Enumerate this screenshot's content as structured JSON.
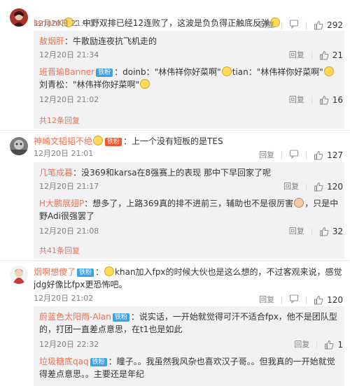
{
  "comments": [
    {
      "user": "larianK",
      "text": "：中野双排已经12连败了，这波是负负得正触底反弹",
      "time": "12月20日 21:00",
      "reply": "回复",
      "likes": "292",
      "subs": [
        {
          "user": "敖烟肝",
          "text": "：牛散励连夜抗飞机走的",
          "time": "12月20日 21:34",
          "reply": "回复",
          "likes": "21"
        },
        {
          "user": "班晋瑜Banner",
          "badge": "铁粉",
          "text1": "：doinb：\"林伟祥你好菜啊\"",
          "text2": "tian：\"林伟祥你好菜啊\"",
          "text3": "刘青松：\"林伟祥你好菜啊\"",
          "time": "12月20日 21:02",
          "reply": "回复",
          "likes": "16"
        }
      ],
      "more": "共12条回复"
    },
    {
      "user": "神崎文韬韬不绝",
      "badge": "铁粉",
      "text": "：上一个没有短板的是TES",
      "time": "12月20日 21:01",
      "reply": "回复",
      "likes": "127",
      "subs": [
        {
          "user": "几笔成暮",
          "text": "：没369和karsa在8强赛上的表现 那中下早回家了呢",
          "time": "12月20日 21:17",
          "reply": "回复",
          "likes": "120"
        },
        {
          "user": "H大鹏展翅P",
          "text": "：想多了，上路369真的排不进前三，辅助也不是很厉害",
          "text2": "，只是中野Adi很强罢了",
          "time": "12月20日 21:08",
          "reply": "回复",
          "likes": "32"
        }
      ],
      "more": "共41条回复"
    },
    {
      "user": "烟啊想傻了",
      "badge": "铁粉",
      "text": "khan加入fpx的时候大伙也是这么想的，不过客观来说，感觉jdg好像比fpx更恐怖吧。",
      "time": "12月20日 21:02",
      "reply": "回复",
      "likes": "120",
      "subs": [
        {
          "user": "蔚蓝色太阳雨-Alan",
          "badge": "铁粉",
          "text": "：说实话，一开始就觉得可汗不适合fpx，他不是团队型的，打团一直差点意思，在t1也是如此",
          "time": "12月20日 22:32",
          "reply": "回复",
          "likes": "1"
        },
        {
          "user": "垃圾糖底qaq",
          "badge": "铁粉",
          "text": "：瞳子。。我虽然我风杂也喜欢汉子哥。。但我真的一开始就觉得差点意思。。主要还是年纪"
        }
      ]
    }
  ],
  "colors": {
    "username": "#eb7350",
    "meta": "#808080",
    "subbg": "#f2f2f5"
  }
}
